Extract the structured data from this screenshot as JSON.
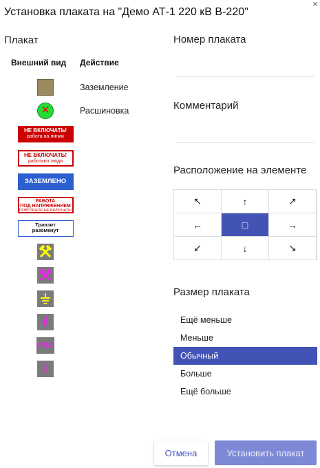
{
  "dialog": {
    "title": "Установка плаката на \"Демо АТ-1 220 кВ В-220\"",
    "close_glyph": "×"
  },
  "poster_section": {
    "title": "Плакат",
    "col_appearance": "Внешний вид",
    "col_action": "Действие",
    "items": [
      {
        "kind": "square",
        "color": "#9a8a5e",
        "action": "Заземление"
      },
      {
        "kind": "circle-x",
        "color": "#22dd33",
        "glyph": "✕",
        "action": "Расшиновка"
      },
      {
        "kind": "sign",
        "style": "red",
        "line1": "НЕ ВКЛЮЧАТЬ!",
        "line2": "работа на линии"
      },
      {
        "kind": "sign",
        "style": "red-outline",
        "line1": "НЕ ВКЛЮЧАТЬ!",
        "line2": "работают люди"
      },
      {
        "kind": "sign",
        "style": "blue",
        "line1": "ЗАЗЕМЛЕНО"
      },
      {
        "kind": "sign",
        "style": "work",
        "line1": "РАБОТА",
        "line2": "ПОД НАПРЯЖЕНИЕМ",
        "line3": "ПОВТОРНОЕ НЕ ВКЛЮЧАТЬ!"
      },
      {
        "kind": "sign",
        "style": "transit",
        "line1": "Транзит",
        "line2": "разомкнут"
      },
      {
        "kind": "icon",
        "icon": "hammers-icon",
        "color": "#ffff00"
      },
      {
        "kind": "icon",
        "icon": "hammers-icon",
        "color": "#ee22ee"
      },
      {
        "kind": "icon",
        "icon": "ground-icon",
        "color": "#ffff00"
      },
      {
        "kind": "icon",
        "icon": "lightning-icon",
        "color": "#ee22ee"
      },
      {
        "kind": "icon",
        "icon": "rza-text",
        "color": "#ee22ee",
        "text": "РЗА"
      },
      {
        "kind": "icon",
        "icon": "info-icon",
        "color": "#ee22ee",
        "text": "i"
      }
    ]
  },
  "number_section": {
    "title": "Номер плаката",
    "value": ""
  },
  "comment_section": {
    "title": "Комментарий",
    "value": ""
  },
  "position_section": {
    "title": "Расположение на элементе",
    "cells": [
      "↖",
      "↑",
      "↗",
      "←",
      "□",
      "→",
      "↙",
      "↓",
      "↘"
    ],
    "selected_index": 4
  },
  "size_section": {
    "title": "Размер плаката",
    "options": [
      "Ещё меньше",
      "Меньше",
      "Обычный",
      "Больше",
      "Ещё больше"
    ],
    "selected_index": 2
  },
  "buttons": {
    "cancel": "Отмена",
    "apply": "Установить плакат"
  },
  "colors": {
    "accent": "#4253b5",
    "accent_disabled": "#7d89d6"
  }
}
